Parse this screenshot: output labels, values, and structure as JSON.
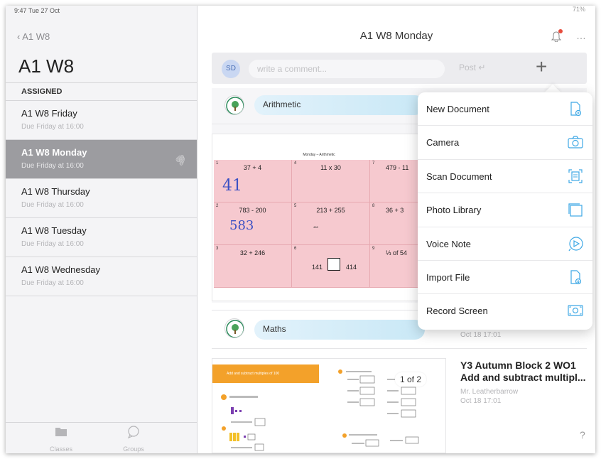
{
  "sidebar": {
    "status_left": "9:47  Tue 27 Oct",
    "back_label": "A1 W8",
    "title": "A1 W8",
    "section_header": "ASSIGNED",
    "items": [
      {
        "title": "A1 W8 Friday",
        "due": "Due Friday at 16:00"
      },
      {
        "title": "A1 W8 Monday",
        "due": "Due Friday at 16:00"
      },
      {
        "title": "A1 W8 Thursday",
        "due": "Due Friday at 16:00"
      },
      {
        "title": "A1 W8 Tuesday",
        "due": "Due Friday at 16:00"
      },
      {
        "title": "A1 W8 Wednesday",
        "due": "Due Friday at 16:00"
      }
    ],
    "selected_index": 1,
    "tabs": [
      {
        "label": "Classes",
        "icon": "folder-icon"
      },
      {
        "label": "Groups",
        "icon": "chat-bubble-icon"
      }
    ]
  },
  "main": {
    "status_right": "71%",
    "title": "A1 W8 Monday",
    "more_label": "…",
    "comment": {
      "avatar": "SD",
      "placeholder": "write a comment...",
      "post_label": "Post",
      "plus_label": "+"
    },
    "feed": [
      {
        "topic": "Arithmetic"
      },
      {
        "topic": "Maths"
      }
    ],
    "worksheet": {
      "title": "Monday – Arithmetic",
      "cells": [
        {
          "n": "1",
          "q": "37 + 4",
          "answer": "41"
        },
        {
          "n": "4",
          "q": "11 x 30"
        },
        {
          "n": "7",
          "q": "479 - 11"
        },
        {
          "n": "2",
          "q": "783 - 200",
          "answer": "583"
        },
        {
          "n": "5",
          "q": "213 + 255",
          "sub": "468"
        },
        {
          "n": "8",
          "q": "36 + 3"
        },
        {
          "n": "3",
          "q": "32 + 246"
        },
        {
          "n": "6",
          "q": "",
          "left": "141",
          "right": "414"
        },
        {
          "n": "9",
          "q": "⅓ of 54"
        }
      ]
    },
    "maths_doc": {
      "banner": "Add and subtract multiples of 100",
      "pager": "1 of 2",
      "title": "Y3 Autumn Block 2 WO1 Add and subtract multipl...",
      "author": "Mr. Leatherbarrow",
      "date": "Oct 18 17:01",
      "prev_date": "Oct 18 17:01"
    },
    "help_label": "?"
  },
  "menu": {
    "items": [
      {
        "label": "New Document",
        "icon": "new-document-icon"
      },
      {
        "label": "Camera",
        "icon": "camera-icon"
      },
      {
        "label": "Scan Document",
        "icon": "scan-document-icon"
      },
      {
        "label": "Photo Library",
        "icon": "photo-library-icon"
      },
      {
        "label": "Voice Note",
        "icon": "voice-note-icon"
      },
      {
        "label": "Import File",
        "icon": "import-file-icon"
      },
      {
        "label": "Record Screen",
        "icon": "record-screen-icon"
      }
    ],
    "icon_color": "#3ea8e5"
  },
  "colors": {
    "accent": "#3ea8e5",
    "selected_row": "#9c9ca0",
    "worksheet_pink": "#f6c9cf",
    "handwriting": "#3b50c4",
    "orange": "#f3a12a"
  }
}
